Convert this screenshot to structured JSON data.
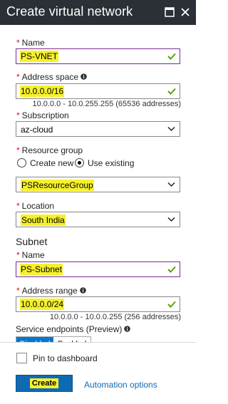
{
  "header": {
    "title": "Create virtual network",
    "maximize_icon": "maximize-icon",
    "close_icon": "close-icon"
  },
  "form": {
    "name": {
      "label": "Name",
      "required": "*",
      "value": "PS-VNET"
    },
    "address_space": {
      "label": "Address space",
      "required": "*",
      "value": "10.0.0.0/16",
      "hint": "10.0.0.0 - 10.0.255.255 (65536 addresses)"
    },
    "subscription": {
      "label": "Subscription",
      "required": "*",
      "value": "az-cloud"
    },
    "resource_group": {
      "label": "Resource group",
      "required": "*",
      "options": [
        "Create new",
        "Use existing"
      ],
      "selected_option": "Use existing",
      "value": "PSResourceGroup"
    },
    "location": {
      "label": "Location",
      "required": "*",
      "value": "South India"
    },
    "subnet": {
      "title": "Subnet",
      "name": {
        "label": "Name",
        "required": "*",
        "value": "PS-Subnet"
      },
      "address_range": {
        "label": "Address range",
        "required": "*",
        "value": "10.0.0.0/24",
        "hint": "10.0.0.0 - 10.0.0.255 (256 addresses)"
      }
    },
    "service_endpoints": {
      "label": "Service endpoints (Preview)",
      "options": [
        "Disabled",
        "Enabled"
      ],
      "selected": "Disabled"
    }
  },
  "footer": {
    "pin_label": "Pin to dashboard",
    "pin_checked": false,
    "create_label": "Create",
    "automation_label": "Automation options"
  },
  "colors": {
    "header_bg": "#2b2f36",
    "highlight": "#f6f12a",
    "valid_check": "#57a300",
    "required": "#e00b1c",
    "primary_button": "#0f6ab4",
    "active_border": "#7b2a96"
  }
}
